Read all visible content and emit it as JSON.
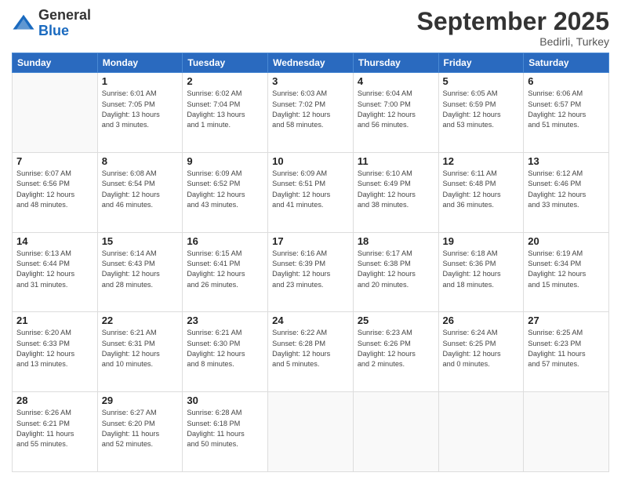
{
  "header": {
    "logo_general": "General",
    "logo_blue": "Blue",
    "title": "September 2025",
    "location": "Bedirli, Turkey"
  },
  "weekdays": [
    "Sunday",
    "Monday",
    "Tuesday",
    "Wednesday",
    "Thursday",
    "Friday",
    "Saturday"
  ],
  "weeks": [
    [
      {
        "day": "",
        "info": ""
      },
      {
        "day": "1",
        "info": "Sunrise: 6:01 AM\nSunset: 7:05 PM\nDaylight: 13 hours\nand 3 minutes."
      },
      {
        "day": "2",
        "info": "Sunrise: 6:02 AM\nSunset: 7:04 PM\nDaylight: 13 hours\nand 1 minute."
      },
      {
        "day": "3",
        "info": "Sunrise: 6:03 AM\nSunset: 7:02 PM\nDaylight: 12 hours\nand 58 minutes."
      },
      {
        "day": "4",
        "info": "Sunrise: 6:04 AM\nSunset: 7:00 PM\nDaylight: 12 hours\nand 56 minutes."
      },
      {
        "day": "5",
        "info": "Sunrise: 6:05 AM\nSunset: 6:59 PM\nDaylight: 12 hours\nand 53 minutes."
      },
      {
        "day": "6",
        "info": "Sunrise: 6:06 AM\nSunset: 6:57 PM\nDaylight: 12 hours\nand 51 minutes."
      }
    ],
    [
      {
        "day": "7",
        "info": "Sunrise: 6:07 AM\nSunset: 6:56 PM\nDaylight: 12 hours\nand 48 minutes."
      },
      {
        "day": "8",
        "info": "Sunrise: 6:08 AM\nSunset: 6:54 PM\nDaylight: 12 hours\nand 46 minutes."
      },
      {
        "day": "9",
        "info": "Sunrise: 6:09 AM\nSunset: 6:52 PM\nDaylight: 12 hours\nand 43 minutes."
      },
      {
        "day": "10",
        "info": "Sunrise: 6:09 AM\nSunset: 6:51 PM\nDaylight: 12 hours\nand 41 minutes."
      },
      {
        "day": "11",
        "info": "Sunrise: 6:10 AM\nSunset: 6:49 PM\nDaylight: 12 hours\nand 38 minutes."
      },
      {
        "day": "12",
        "info": "Sunrise: 6:11 AM\nSunset: 6:48 PM\nDaylight: 12 hours\nand 36 minutes."
      },
      {
        "day": "13",
        "info": "Sunrise: 6:12 AM\nSunset: 6:46 PM\nDaylight: 12 hours\nand 33 minutes."
      }
    ],
    [
      {
        "day": "14",
        "info": "Sunrise: 6:13 AM\nSunset: 6:44 PM\nDaylight: 12 hours\nand 31 minutes."
      },
      {
        "day": "15",
        "info": "Sunrise: 6:14 AM\nSunset: 6:43 PM\nDaylight: 12 hours\nand 28 minutes."
      },
      {
        "day": "16",
        "info": "Sunrise: 6:15 AM\nSunset: 6:41 PM\nDaylight: 12 hours\nand 26 minutes."
      },
      {
        "day": "17",
        "info": "Sunrise: 6:16 AM\nSunset: 6:39 PM\nDaylight: 12 hours\nand 23 minutes."
      },
      {
        "day": "18",
        "info": "Sunrise: 6:17 AM\nSunset: 6:38 PM\nDaylight: 12 hours\nand 20 minutes."
      },
      {
        "day": "19",
        "info": "Sunrise: 6:18 AM\nSunset: 6:36 PM\nDaylight: 12 hours\nand 18 minutes."
      },
      {
        "day": "20",
        "info": "Sunrise: 6:19 AM\nSunset: 6:34 PM\nDaylight: 12 hours\nand 15 minutes."
      }
    ],
    [
      {
        "day": "21",
        "info": "Sunrise: 6:20 AM\nSunset: 6:33 PM\nDaylight: 12 hours\nand 13 minutes."
      },
      {
        "day": "22",
        "info": "Sunrise: 6:21 AM\nSunset: 6:31 PM\nDaylight: 12 hours\nand 10 minutes."
      },
      {
        "day": "23",
        "info": "Sunrise: 6:21 AM\nSunset: 6:30 PM\nDaylight: 12 hours\nand 8 minutes."
      },
      {
        "day": "24",
        "info": "Sunrise: 6:22 AM\nSunset: 6:28 PM\nDaylight: 12 hours\nand 5 minutes."
      },
      {
        "day": "25",
        "info": "Sunrise: 6:23 AM\nSunset: 6:26 PM\nDaylight: 12 hours\nand 2 minutes."
      },
      {
        "day": "26",
        "info": "Sunrise: 6:24 AM\nSunset: 6:25 PM\nDaylight: 12 hours\nand 0 minutes."
      },
      {
        "day": "27",
        "info": "Sunrise: 6:25 AM\nSunset: 6:23 PM\nDaylight: 11 hours\nand 57 minutes."
      }
    ],
    [
      {
        "day": "28",
        "info": "Sunrise: 6:26 AM\nSunset: 6:21 PM\nDaylight: 11 hours\nand 55 minutes."
      },
      {
        "day": "29",
        "info": "Sunrise: 6:27 AM\nSunset: 6:20 PM\nDaylight: 11 hours\nand 52 minutes."
      },
      {
        "day": "30",
        "info": "Sunrise: 6:28 AM\nSunset: 6:18 PM\nDaylight: 11 hours\nand 50 minutes."
      },
      {
        "day": "",
        "info": ""
      },
      {
        "day": "",
        "info": ""
      },
      {
        "day": "",
        "info": ""
      },
      {
        "day": "",
        "info": ""
      }
    ]
  ]
}
